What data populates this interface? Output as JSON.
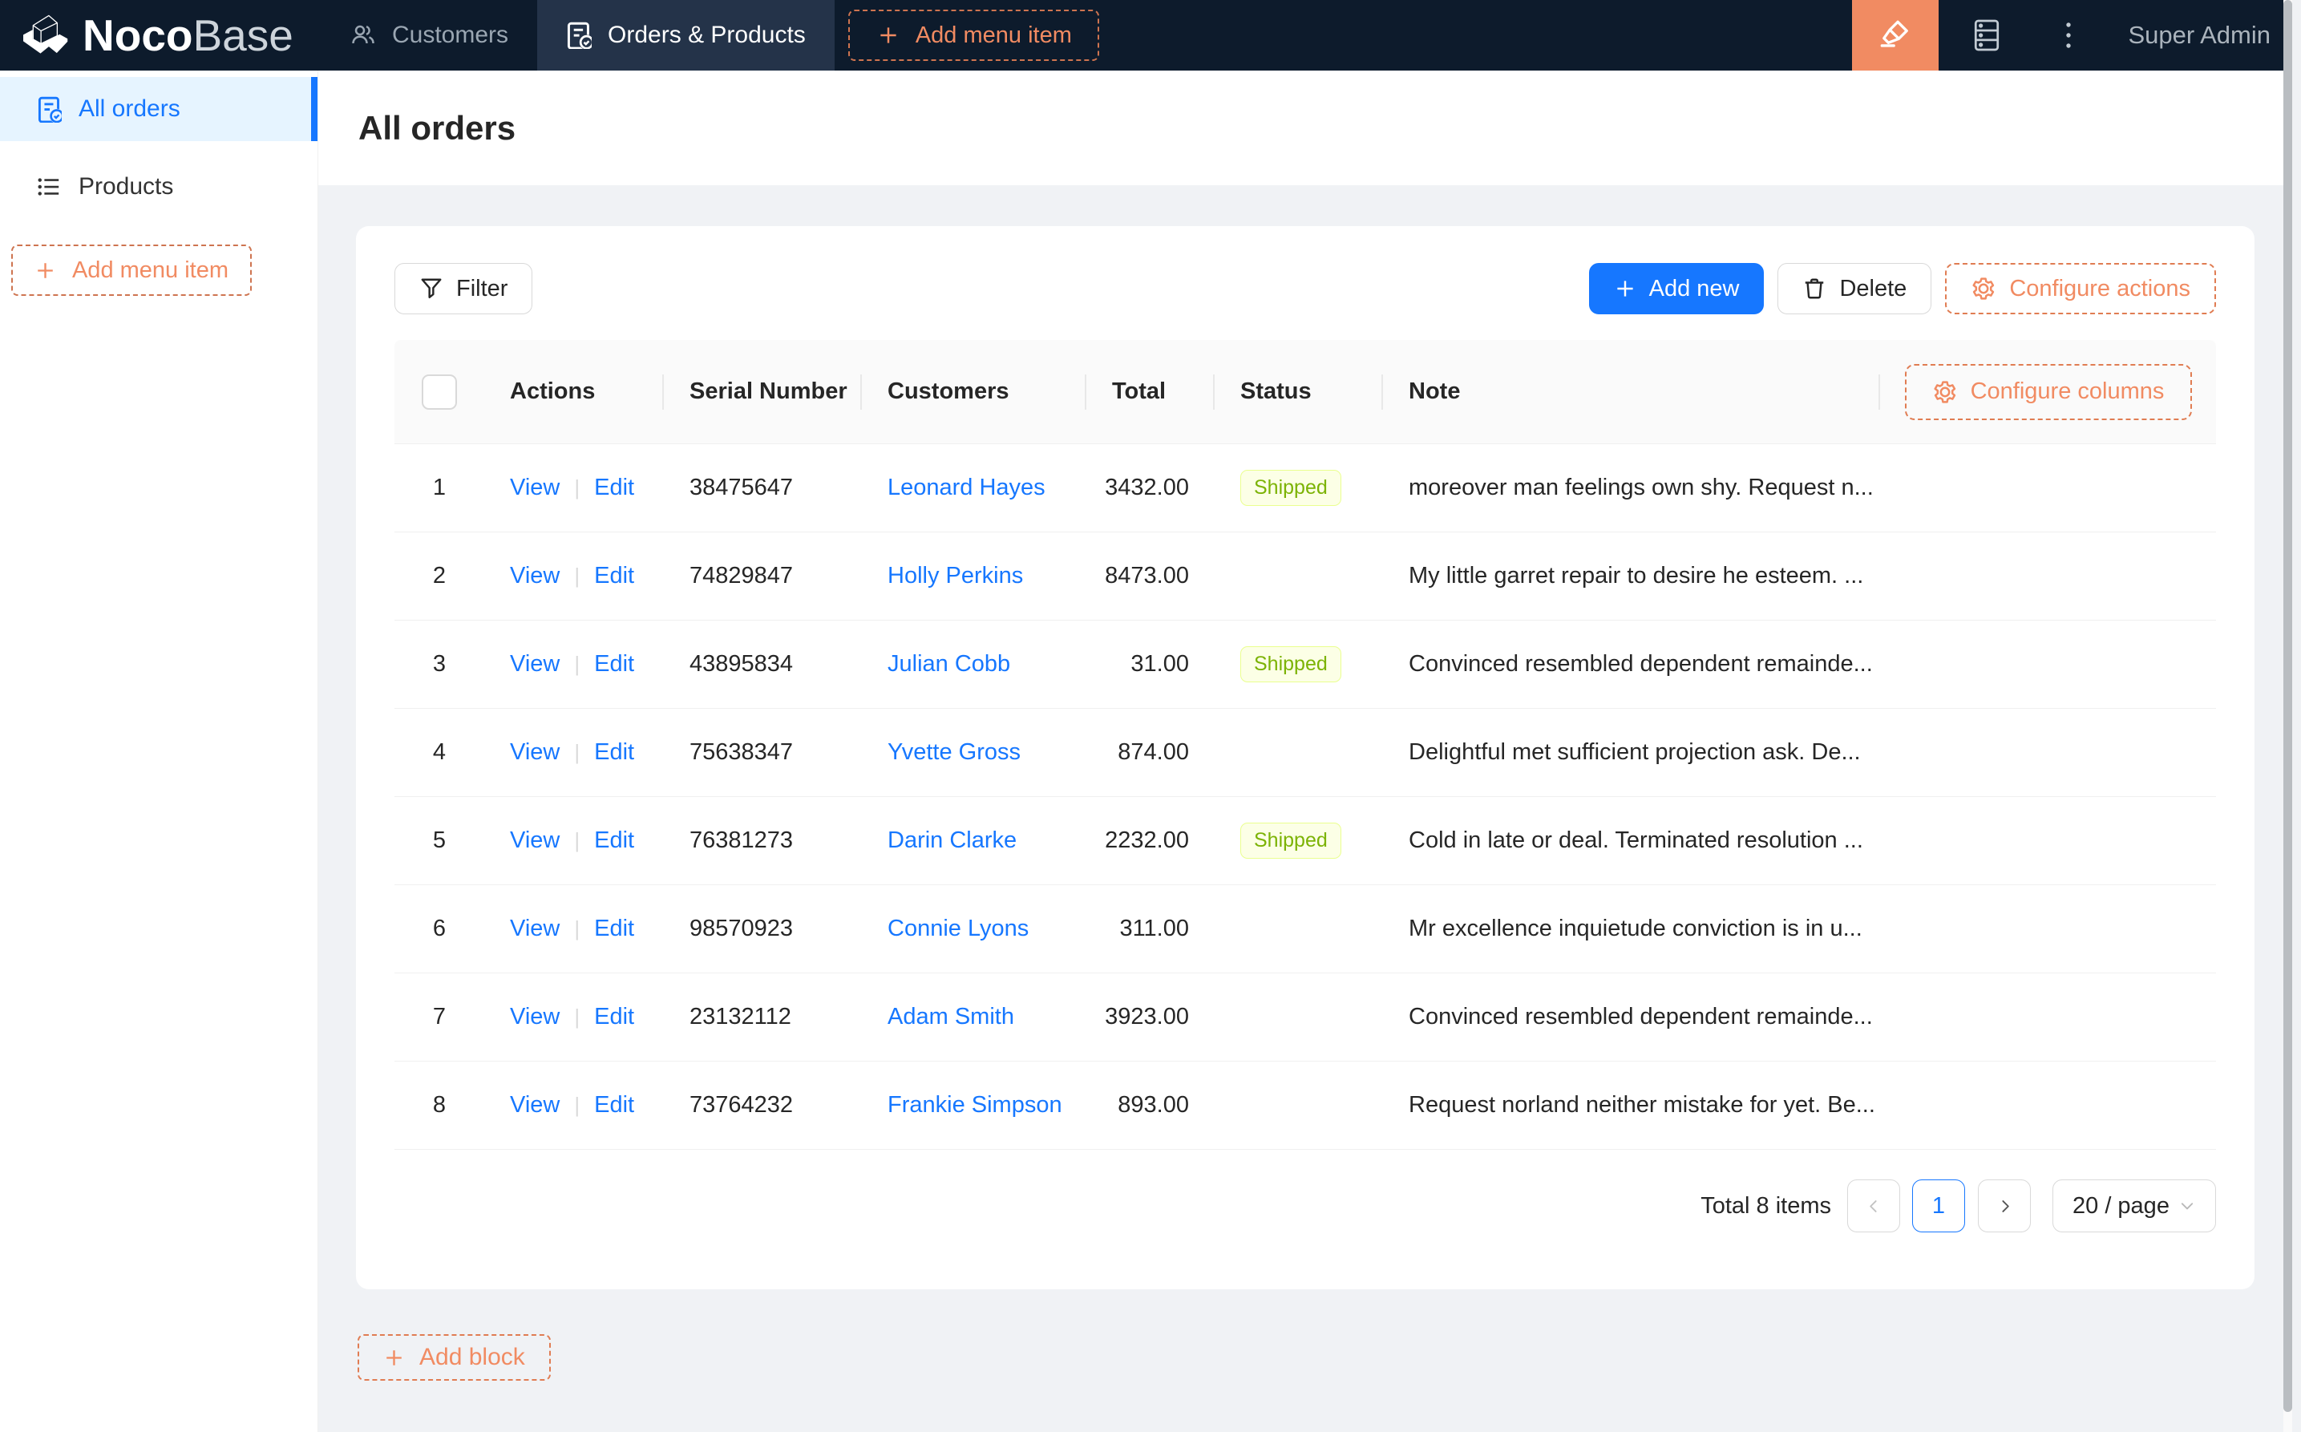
{
  "navbar": {
    "logo": {
      "bold": "Noco",
      "light": "Base"
    },
    "items": [
      {
        "label": "Customers",
        "icon": "team-icon",
        "active": false
      },
      {
        "label": "Orders & Products",
        "icon": "orders-icon",
        "active": true
      }
    ],
    "add_menu_item_label": "Add menu item",
    "user": "Super Admin"
  },
  "sidebar": {
    "items": [
      {
        "label": "All orders",
        "icon": "orders-icon",
        "active": true
      },
      {
        "label": "Products",
        "icon": "list-icon",
        "active": false
      }
    ],
    "add_menu_item_label": "Add menu item"
  },
  "page": {
    "title": "All orders"
  },
  "toolbar": {
    "filter_label": "Filter",
    "add_new_label": "Add new",
    "delete_label": "Delete",
    "configure_actions_label": "Configure actions"
  },
  "table": {
    "columns": [
      "Actions",
      "Serial Number",
      "Customers",
      "Total",
      "Status",
      "Note"
    ],
    "configure_columns_label": "Configure columns",
    "view_label": "View",
    "edit_label": "Edit",
    "rows": [
      {
        "index": "1",
        "serial": "38475647",
        "customer": "Leonard Hayes",
        "total": "3432.00",
        "status": "Shipped",
        "note": "moreover man feelings own shy. Request n..."
      },
      {
        "index": "2",
        "serial": "74829847",
        "customer": "Holly Perkins",
        "total": "8473.00",
        "status": "",
        "note": "My little garret repair to desire he esteem. ..."
      },
      {
        "index": "3",
        "serial": "43895834",
        "customer": "Julian Cobb",
        "total": "31.00",
        "status": "Shipped",
        "note": "Convinced resembled dependent remainde..."
      },
      {
        "index": "4",
        "serial": "75638347",
        "customer": "Yvette Gross",
        "total": "874.00",
        "status": "",
        "note": "Delightful met sufficient projection ask. De..."
      },
      {
        "index": "5",
        "serial": "76381273",
        "customer": "Darin Clarke",
        "total": "2232.00",
        "status": "Shipped",
        "note": "Cold in late or deal. Terminated resolution ..."
      },
      {
        "index": "6",
        "serial": "98570923",
        "customer": "Connie Lyons",
        "total": "311.00",
        "status": "",
        "note": "Mr excellence inquietude conviction is in u..."
      },
      {
        "index": "7",
        "serial": "23132112",
        "customer": "Adam Smith",
        "total": "3923.00",
        "status": "",
        "note": "Convinced resembled dependent remainde..."
      },
      {
        "index": "8",
        "serial": "73764232",
        "customer": "Frankie Simpson",
        "total": "893.00",
        "status": "",
        "note": "Request norland neither mistake for yet. Be..."
      }
    ]
  },
  "pagination": {
    "total_text": "Total 8 items",
    "current_page": "1",
    "page_size": "20 / page"
  },
  "add_block_label": "Add block",
  "colors": {
    "navbar_bg": "#0d1b2c",
    "accent_orange": "#f18b62",
    "primary_blue": "#1677ff",
    "tag_lime_bg": "#fcffe6",
    "tag_lime_border": "#eaff8f",
    "tag_lime_text": "#7cb305"
  }
}
